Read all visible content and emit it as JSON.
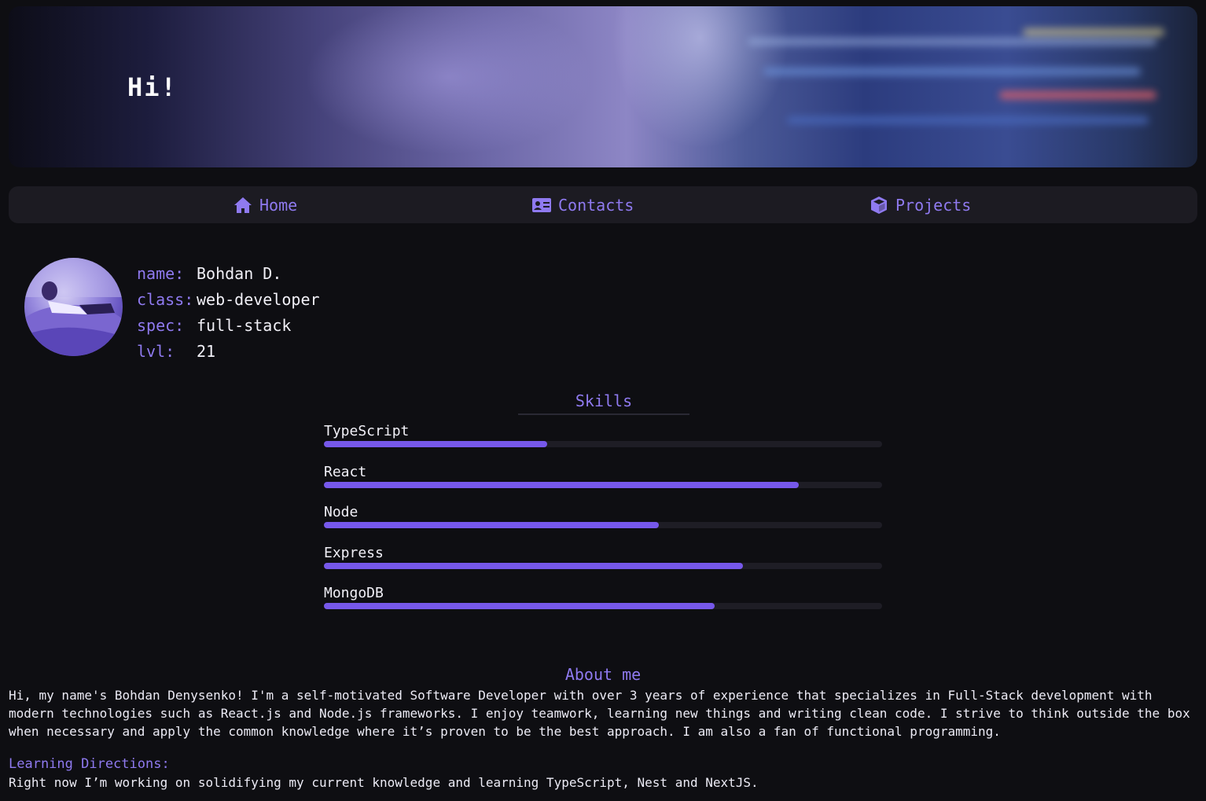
{
  "banner": {
    "greeting": "Hi!"
  },
  "nav": {
    "items": [
      {
        "label": "Home",
        "icon": "home-icon"
      },
      {
        "label": "Contacts",
        "icon": "contact-card-icon"
      },
      {
        "label": "Projects",
        "icon": "cube-icon"
      }
    ]
  },
  "profile": {
    "rows": [
      {
        "key": "name:",
        "value": "Bohdan D."
      },
      {
        "key": "class:",
        "value": "web-developer"
      },
      {
        "key": "spec:",
        "value": "full-stack"
      },
      {
        "key": "lvl:",
        "value": "21"
      }
    ]
  },
  "skills": {
    "title": "Skills",
    "items": [
      {
        "name": "TypeScript",
        "level": 0.4
      },
      {
        "name": "React",
        "level": 0.85
      },
      {
        "name": "Node",
        "level": 0.6
      },
      {
        "name": "Express",
        "level": 0.75
      },
      {
        "name": "MongoDB",
        "level": 0.7
      }
    ]
  },
  "about": {
    "title": "About me",
    "text": "Hi, my name's Bohdan Denysenko! I'm a self-motivated Software Developer with over 3 years of experience that specializes in Full-Stack development with modern technologies such as React.js and Node.js frameworks. I enjoy teamwork, learning new things and writing clean code. I strive to think outside the box when necessary and apply the common knowledge where it’s proven to be the best approach. I am also a fan of functional programming.",
    "learning_title": "Learning Directions:",
    "learning_text": "Right now I’m working on solidifying my current knowledge and learning TypeScript, Nest and NextJS."
  },
  "colors": {
    "accent": "#8f7af0",
    "bar": "#7658ea",
    "background": "#0e0e12",
    "panel": "#1c1b22"
  }
}
